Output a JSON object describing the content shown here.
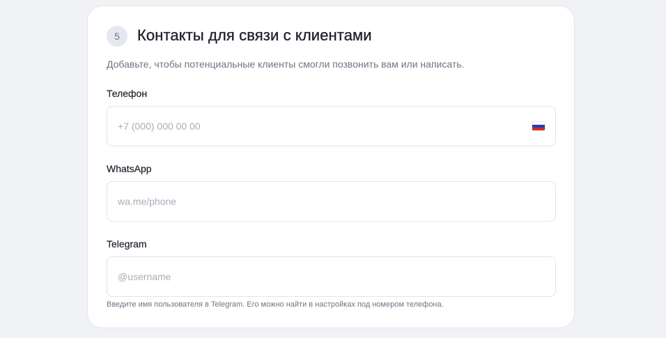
{
  "section": {
    "step_number": "5",
    "title": "Контакты для связи с клиентами",
    "subtitle": "Добавьте, чтобы потенциальные клиенты смогли позвонить вам или написать."
  },
  "phone": {
    "label": "Телефон",
    "placeholder": "+7 (000) 000 00 00",
    "value": "",
    "country_flag_icon": "russia-flag-icon",
    "flag_colors": [
      "#ffffff",
      "#1c3fbf",
      "#d52b1e"
    ]
  },
  "whatsapp": {
    "label": "WhatsApp",
    "placeholder": "wa.me/phone",
    "value": ""
  },
  "telegram": {
    "label": "Telegram",
    "placeholder": "@username",
    "value": "",
    "hint": "Введите имя пользователя в Telegram. Его можно найти в настройках под номером телефона."
  }
}
